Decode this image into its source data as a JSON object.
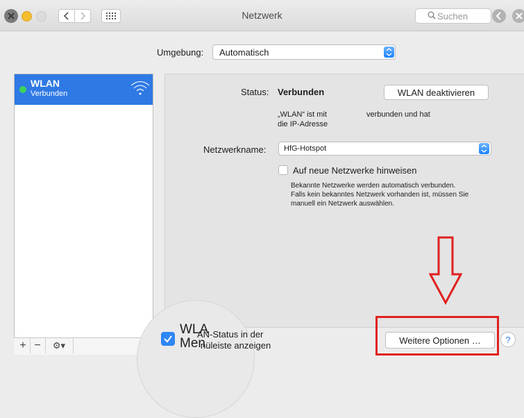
{
  "window": {
    "title": "Netzwerk"
  },
  "toolbar": {
    "search_placeholder": "Suchen",
    "back_icon": "chevron-left-icon",
    "forward_icon": "chevron-right-icon",
    "grid_icon": "grid-icon"
  },
  "location": {
    "label": "Umgebung:",
    "value": "Automatisch"
  },
  "sidebar": {
    "items": [
      {
        "name": "WLAN",
        "status": "Verbunden"
      }
    ],
    "add_label": "+",
    "remove_label": "−",
    "action_label": "⚙▾"
  },
  "detail": {
    "status_label": "Status:",
    "status_value": "Verbunden",
    "turn_off_label": "WLAN deaktivieren",
    "info_line1": "„WLAN“ ist mit",
    "info_line1b": "verbunden und hat",
    "info_line2": "die IP-Adresse",
    "network_label": "Netzwerkname:",
    "network_value": "HfG-Hotspot",
    "ask_label": "Auf neue Netzwerke hinweisen",
    "desc1": "Bekannte Netzwerke werden automatisch verbunden.",
    "desc2": "Falls kein bekanntes Netzwerk vorhanden ist, müssen Sie",
    "desc3": "manuell ein Netzwerk auswählen."
  },
  "bottom": {
    "magnified_line1": "WLA",
    "magnified_line2": "Men",
    "show_line1": "AN-Status in der",
    "show_line2": "nüleiste anzeigen",
    "more_options_label": "Weitere Optionen …",
    "help_label": "?"
  },
  "colors": {
    "accent": "#2e79e4",
    "highlight": "#e02020",
    "connected": "#3dd35a"
  }
}
